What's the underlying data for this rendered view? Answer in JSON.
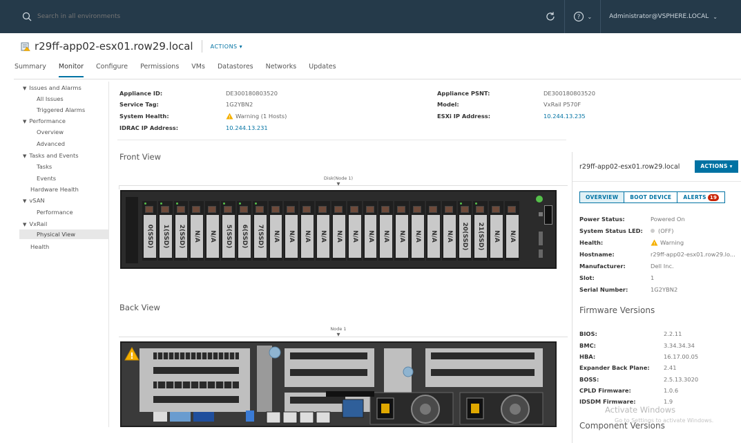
{
  "topbar": {
    "search_placeholder": "Search in all environments",
    "help_label": "?",
    "user": "Administrator@VSPHERE.LOCAL"
  },
  "header": {
    "title": "r29ff-app02-esx01.row29.local",
    "actions": "ACTIONS"
  },
  "tabs": [
    "Summary",
    "Monitor",
    "Configure",
    "Permissions",
    "VMs",
    "Datastores",
    "Networks",
    "Updates"
  ],
  "sidebar": {
    "items": [
      "Issues and Alarms",
      "All Issues",
      "Triggered Alarms",
      "Performance",
      "Overview",
      "Advanced",
      "Tasks and Events",
      "Tasks",
      "Events",
      "Hardware Health",
      "vSAN",
      "Performance",
      "VxRail",
      "Physical View",
      "Health"
    ]
  },
  "info": {
    "appliance_id_label": "Appliance ID:",
    "appliance_id": "DE300180803520",
    "service_tag_label": "Service Tag:",
    "service_tag": "1G2YBN2",
    "system_health_label": "System Health:",
    "system_health": "Warning (1 Hosts)",
    "idrac_label": "IDRAC IP Address:",
    "idrac": "10.244.13.231",
    "psnt_label": "Appliance PSNT:",
    "psnt": "DE300180803520",
    "model_label": "Model:",
    "model": "VxRail P570F",
    "esxi_label": "ESXi IP Address:",
    "esxi": "10.244.13.235"
  },
  "front": {
    "title": "Front View",
    "node_label": "Disk(Node 1)",
    "disks": [
      "0(SSD)",
      "1(SSD)",
      "2(SSD)",
      "N/A",
      "N/A",
      "5(SSD)",
      "6(SSD)",
      "7(SSD)",
      "N/A",
      "N/A",
      "N/A",
      "N/A",
      "N/A",
      "N/A",
      "N/A",
      "N/A",
      "N/A",
      "N/A",
      "N/A",
      "N/A",
      "20(SSD)",
      "21(SSD)",
      "N/A",
      "N/A"
    ]
  },
  "back": {
    "title": "Back View",
    "node_label": "Node 1"
  },
  "panel": {
    "title": "r29ff-app02-esx01.row29.local",
    "actions": "ACTIONS",
    "tab_overview": "OVERVIEW",
    "tab_boot": "BOOT DEVICE",
    "tab_alerts": "ALERTS",
    "alerts_count": "19",
    "power_status_label": "Power Status:",
    "power_status": "Powered On",
    "led_label": "System Status LED:",
    "led": "(OFF)",
    "health_label": "Health:",
    "health": "Warning",
    "hostname_label": "Hostname:",
    "hostname": "r29ff-app02-esx01.row29.lo...",
    "manufacturer_label": "Manufacturer:",
    "manufacturer": "Dell Inc.",
    "slot_label": "Slot:",
    "slot": "1",
    "serial_label": "Serial Number:",
    "serial": "1G2YBN2",
    "firmware_title": "Firmware Versions",
    "bios_label": "BIOS:",
    "bios": "2.2.11",
    "bmc_label": "BMC:",
    "bmc": "3.34.34.34",
    "hba_label": "HBA:",
    "hba": "16.17.00.05",
    "expander_label": "Expander Back Plane:",
    "expander": "2.41",
    "boss_label": "BOSS:",
    "boss": "2.5.13.3020",
    "cpld_label": "CPLD Firmware:",
    "cpld": "1.0.6",
    "idsdm_label": "IDSDM Firmware:",
    "idsdm": "1.9",
    "component_title": "Component Versions"
  },
  "watermark": {
    "line1": "Activate Windows",
    "line2": "Go to Settings to activate Windows."
  },
  "colors": {
    "topbar": "#253a4a",
    "accent": "#0072a3",
    "warning": "#f5b000",
    "alert_badge": "#c92100"
  }
}
